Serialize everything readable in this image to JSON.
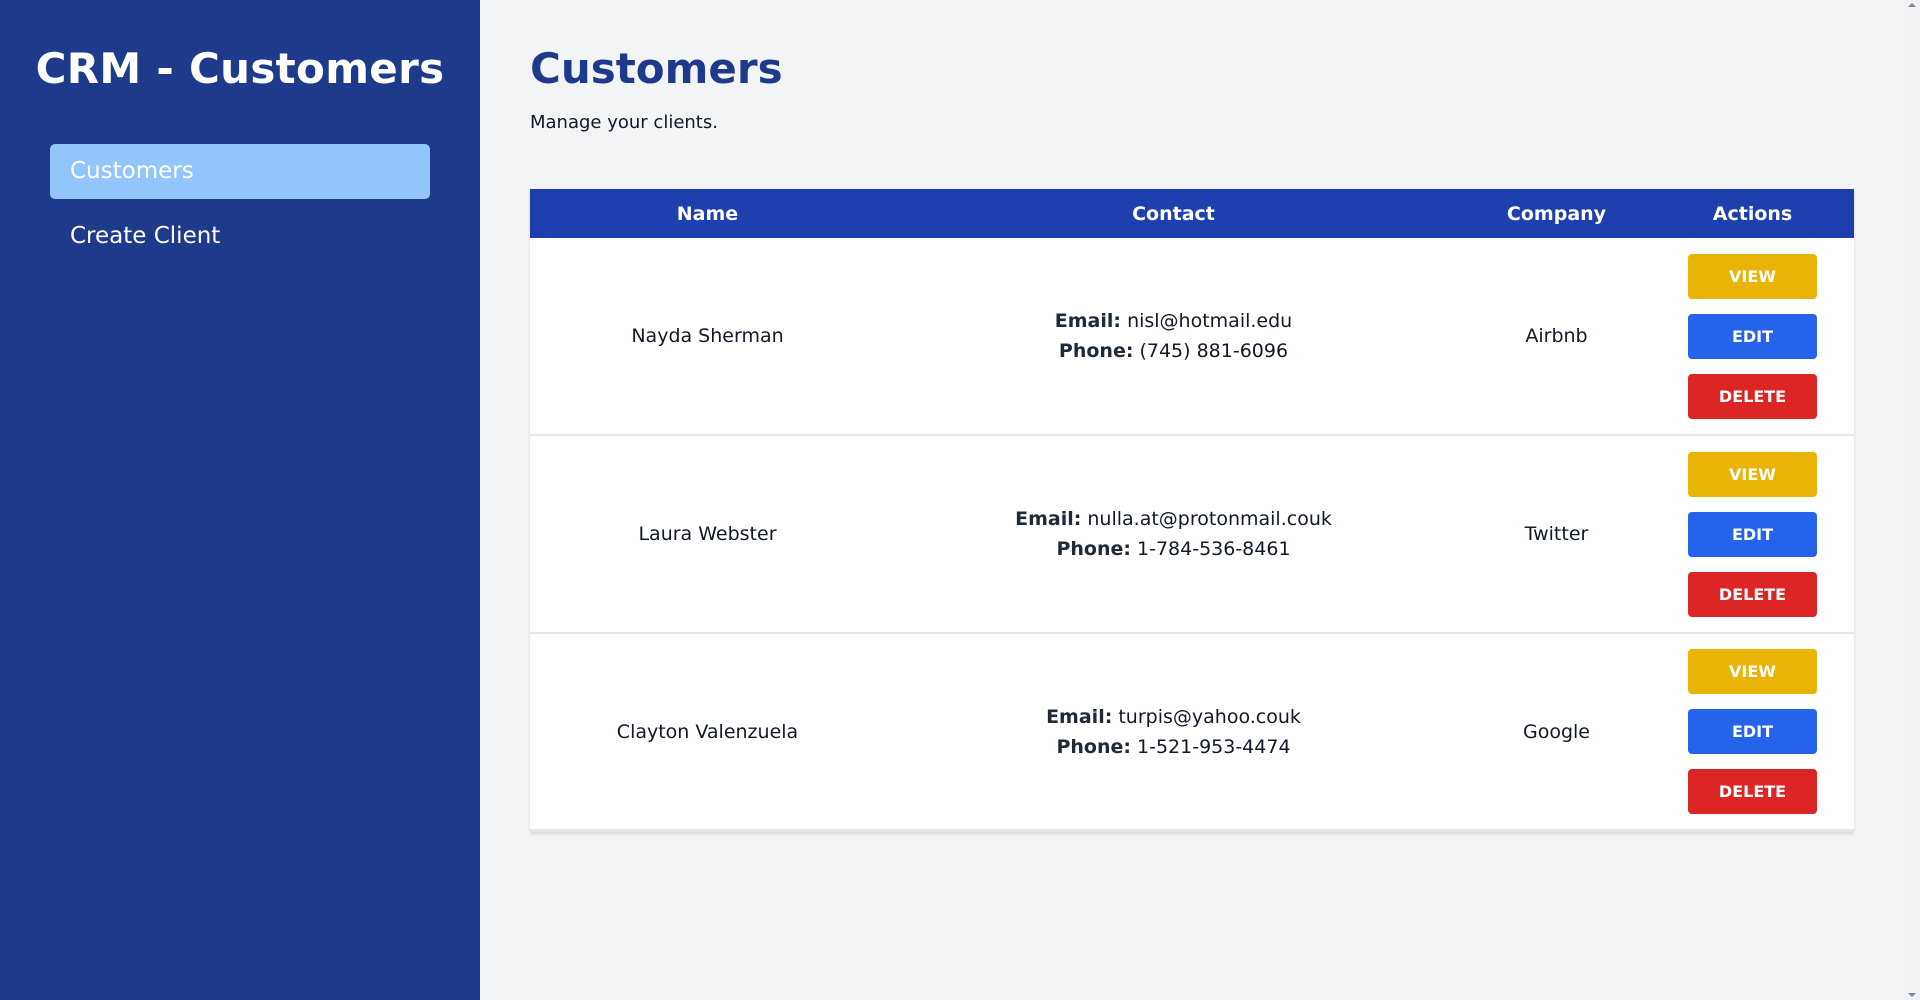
{
  "sidebar": {
    "app_title": "CRM - Customers",
    "nav": [
      {
        "label": "Customers",
        "active": true
      },
      {
        "label": "Create Client",
        "active": false
      }
    ],
    "colors": {
      "background": "#1e3a8a",
      "active_item": "#93c5fd"
    }
  },
  "main": {
    "title": "Customers",
    "subtitle": "Manage your clients.",
    "table": {
      "headers": [
        "Name",
        "Contact",
        "Company",
        "Actions"
      ],
      "email_label": "Email:",
      "phone_label": "Phone:",
      "rows": [
        {
          "name": "Nayda Sherman",
          "email": "nisl@hotmail.edu",
          "phone": "(745) 881-6096",
          "company": "Airbnb"
        },
        {
          "name": "Laura Webster",
          "email": "nulla.at@protonmail.couk",
          "phone": "1-784-536-8461",
          "company": "Twitter"
        },
        {
          "name": "Clayton Valenzuela",
          "email": "turpis@yahoo.couk",
          "phone": "1-521-953-4474",
          "company": "Google"
        }
      ],
      "actions": {
        "view": "VIEW",
        "edit": "EDIT",
        "delete": "DELETE"
      }
    },
    "colors": {
      "header": "#1e40af",
      "title": "#1e3a8a",
      "view": "#eab308",
      "edit": "#2563eb",
      "delete": "#dc2626"
    }
  }
}
